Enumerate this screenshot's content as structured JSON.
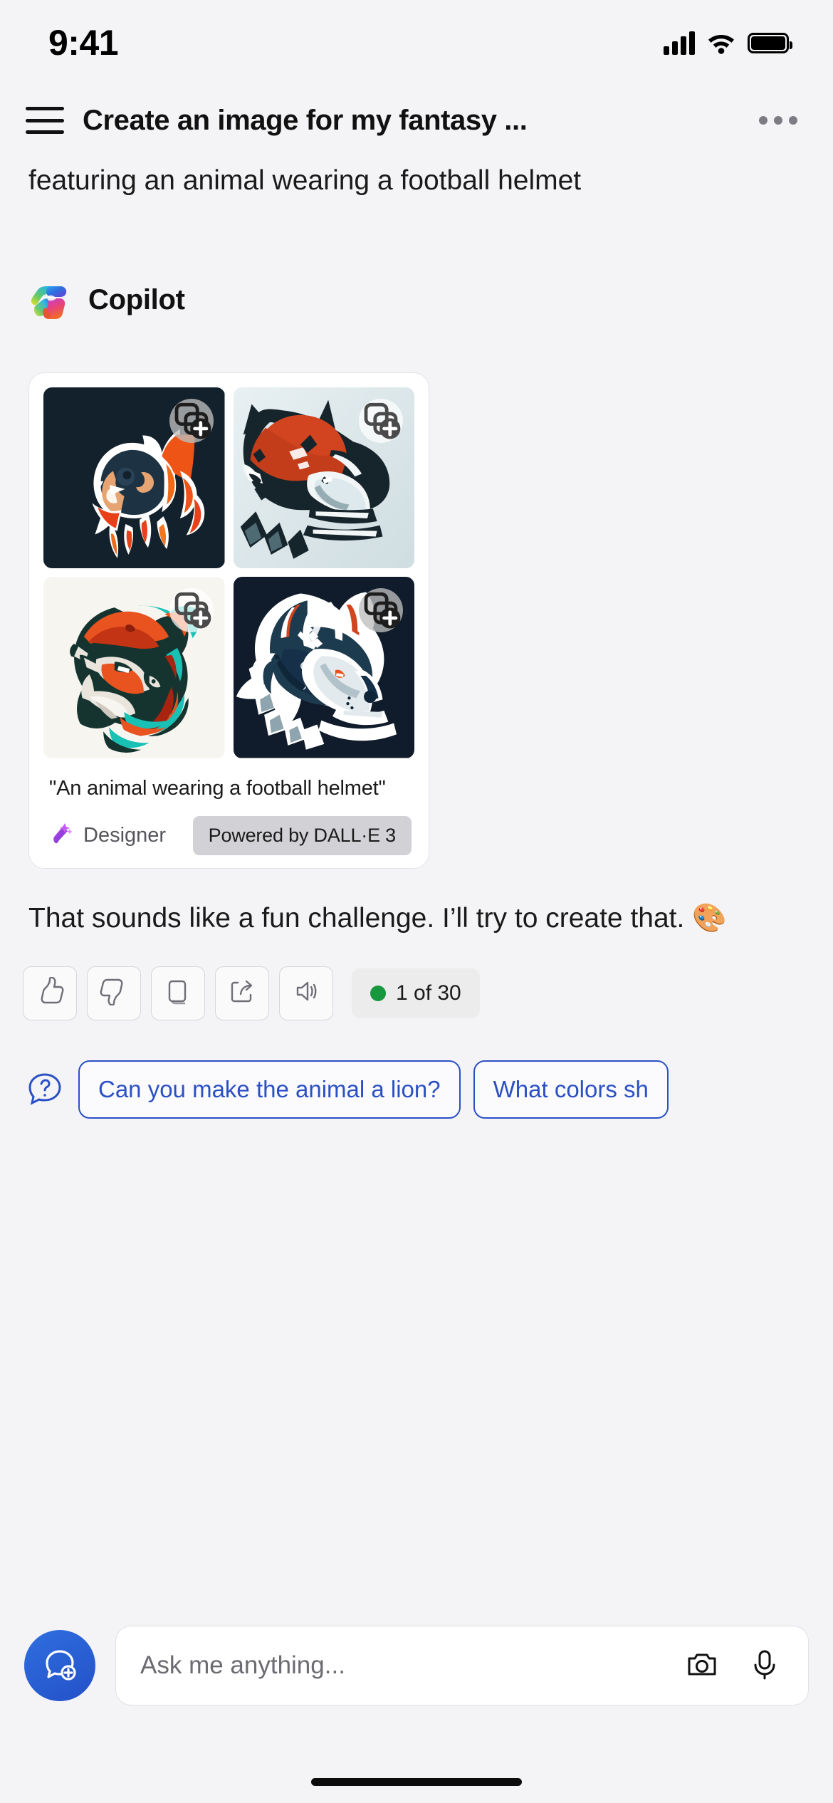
{
  "status_bar": {
    "time": "9:41",
    "signal_icon": "cellular-signal-icon",
    "wifi_icon": "wifi-icon",
    "battery_icon": "battery-full-icon"
  },
  "nav": {
    "menu_icon": "hamburger-menu-icon",
    "title": "Create an image for my fantasy ...",
    "more_icon": "more-options-icon"
  },
  "conversation": {
    "user_message": "featuring an animal wearing a football helmet",
    "bot_name": "Copilot",
    "bot_logo_icon": "copilot-logo-icon",
    "reply_text": "That sounds like a fun challenge. I’ll try to create that. 🎨"
  },
  "image_card": {
    "caption": "\"An animal wearing a football helmet\"",
    "designer_label": "Designer",
    "designer_icon": "designer-wand-icon",
    "powered_by": "Powered by DALL·E 3",
    "add_icon": "add-to-collection-icon",
    "images": [
      {
        "alt": "Lion mascot wearing football helmet with orange flame mane",
        "background": "#13212c",
        "theme": "dark"
      },
      {
        "alt": "Wolf mascot wearing orange football helmet",
        "background": "#dfe9ec",
        "theme": "light"
      },
      {
        "alt": "Gorilla mascot wearing orange helmet with teal mane",
        "background": "#f7f5f0",
        "theme": "light"
      },
      {
        "alt": "White wolf mascot wearing navy football helmet",
        "background": "#101c2b",
        "theme": "dark"
      }
    ]
  },
  "actions": {
    "buttons": [
      {
        "name": "thumbs-up",
        "icon": "thumbs-up-icon"
      },
      {
        "name": "thumbs-down",
        "icon": "thumbs-down-icon"
      },
      {
        "name": "copy",
        "icon": "copy-icon"
      },
      {
        "name": "share",
        "icon": "share-icon"
      },
      {
        "name": "read-aloud",
        "icon": "speaker-icon"
      }
    ],
    "counter_text": "1 of 30",
    "counter_dot_color": "#17983f"
  },
  "suggestions": {
    "help_icon": "question-bubble-icon",
    "accent_color": "#2b50c4",
    "chips": [
      "Can you make the animal a lion?",
      "What colors sh"
    ]
  },
  "composer": {
    "new_chat_icon": "new-chat-icon",
    "placeholder": "Ask me anything...",
    "value": "",
    "camera_icon": "camera-icon",
    "mic_icon": "microphone-icon"
  }
}
